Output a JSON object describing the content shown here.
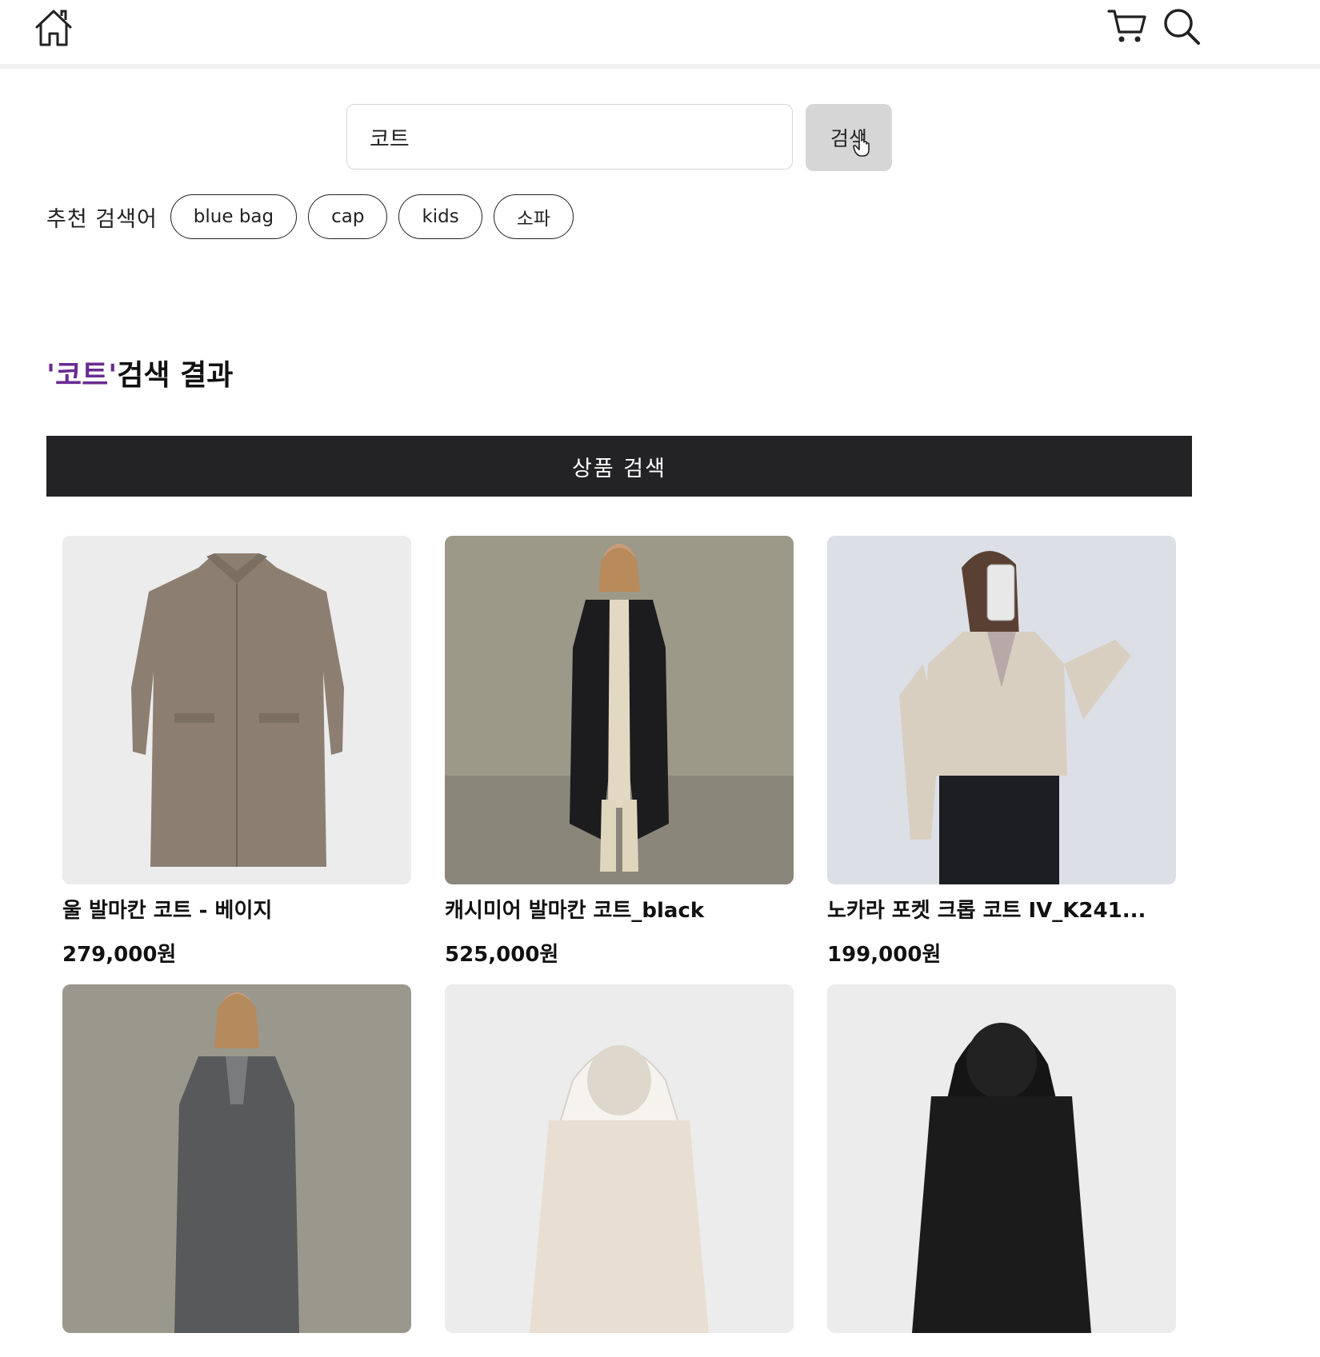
{
  "header": {
    "home_icon": "home-icon",
    "cart_icon": "cart-icon",
    "search_icon": "search-icon"
  },
  "search": {
    "value": "코트",
    "button_label": "검색"
  },
  "recommended": {
    "label": "추천 검색어",
    "keywords": [
      "blue bag",
      "cap",
      "kids",
      "소파"
    ]
  },
  "results": {
    "keyword_display": "'코트'",
    "title_suffix": "검색 결과",
    "keyword_color": "#6a2c91"
  },
  "tab": {
    "label": "상품 검색"
  },
  "products": [
    {
      "name": "울 발마칸 코트 - 베이지",
      "price": "279,000원"
    },
    {
      "name": "캐시미어 발마칸 코트_black",
      "price": "525,000원"
    },
    {
      "name": "노카라 포켓 크롭 코트 IV_K241...",
      "price": "199,000원"
    },
    {
      "name": "",
      "price": ""
    },
    {
      "name": "",
      "price": ""
    },
    {
      "name": "",
      "price": ""
    }
  ]
}
